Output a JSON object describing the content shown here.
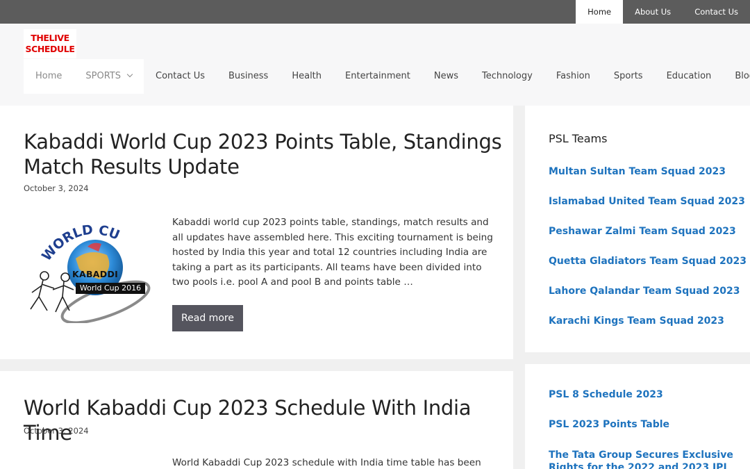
{
  "topbar": {
    "items": [
      {
        "label": "Home",
        "active": true
      },
      {
        "label": "About Us",
        "active": false
      },
      {
        "label": "Contact Us",
        "active": false
      }
    ]
  },
  "logo": {
    "line1": "THELIVE",
    "line2": "SCHEDULE"
  },
  "nav": {
    "home": "Home",
    "sports_menu": "SPORTS",
    "items": [
      "Contact Us",
      "Business",
      "Health",
      "Entertainment",
      "News",
      "Technology",
      "Fashion",
      "Sports",
      "Education",
      "Blog"
    ]
  },
  "posts": [
    {
      "title_line1": "Kabaddi World Cup 2023 Points Table, Standings",
      "title_line2": "Match Results Update",
      "date": "October 3, 2024",
      "excerpt": "Kabaddi world cup 2023 points table, standings, match results and all updates have assembled here. This exciting tournament is being hosted by India this year and total 12 countries including India are taking a part as its participants. All teams have been divided into two pools i.e. pool A and pool B and points table …",
      "read_more": "Read more",
      "thumb_arc": "WORLD CUP",
      "thumb_brand": "KABADDI",
      "thumb_caption": "World Cup 2016"
    },
    {
      "title": "World Kabaddi Cup 2023 Schedule With India Time",
      "date": "October 3, 2024",
      "excerpt": "World Kabaddi Cup 2023 schedule with India time table has been"
    }
  ],
  "sidebar": {
    "widget1_title": "PSL Teams",
    "widget1_links": [
      "Multan Sultan Team Squad 2023",
      "Islamabad United Team Squad 2023",
      "Peshawar Zalmi Team Squad 2023",
      "Quetta Gladiators Team Squad 2023",
      "Lahore Qalandar Team Squad 2023",
      "Karachi Kings Team Squad 2023"
    ],
    "widget2_links": [
      "PSL 8 Schedule 2023",
      "PSL 2023 Points Table",
      "The Tata Group Secures Exclusive",
      "Rights for the 2022 and 2023 IPL"
    ]
  },
  "colors": {
    "link": "#1e73be",
    "topbar": "#5c5c5c",
    "logo_red": "#e00000",
    "button": "#55555e"
  }
}
